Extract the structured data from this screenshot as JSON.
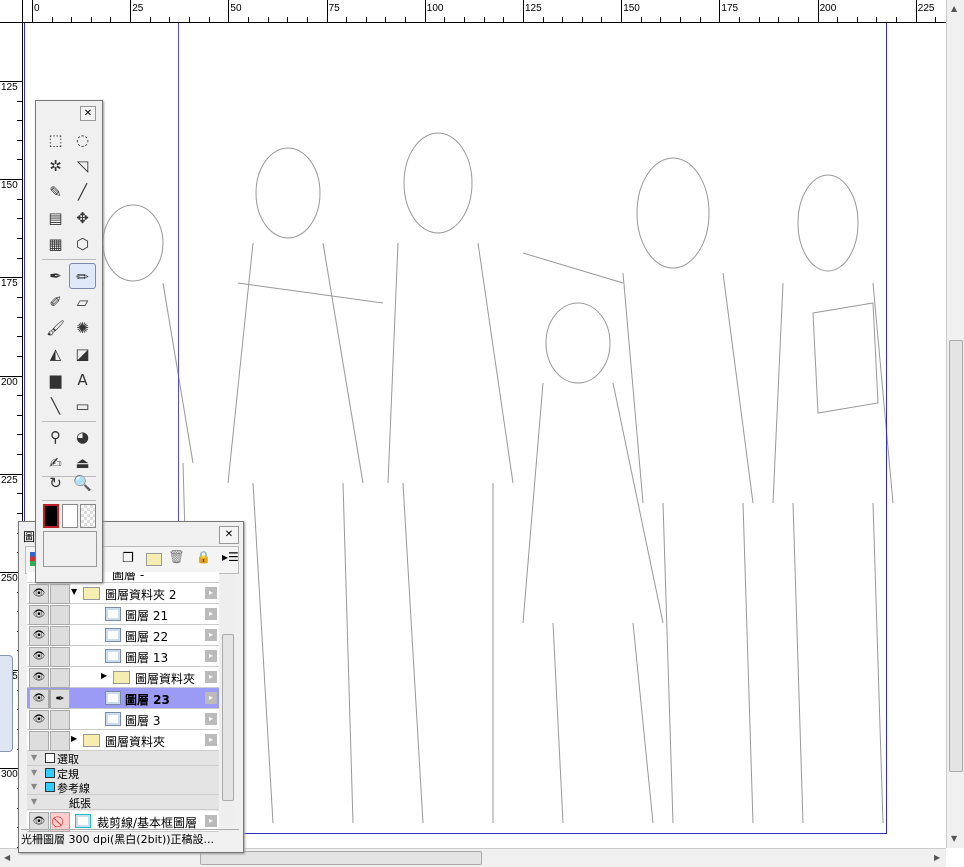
{
  "rulers": {
    "top_labels": [
      "0",
      "25",
      "50",
      "75",
      "100",
      "125",
      "150",
      "175",
      "200",
      "225"
    ],
    "left_labels": [
      "125",
      "150",
      "175",
      "200",
      "225",
      "250",
      "275",
      "300"
    ]
  },
  "toolbox": {
    "close_icon": "close-icon",
    "tools": [
      "rect-select",
      "lasso",
      "magic-wand",
      "object-select",
      "select-pen",
      "eyedropper",
      "perspective",
      "move",
      "grid",
      "3d-select",
      "pen",
      "pencil",
      "marker",
      "eraser",
      "brush",
      "airbrush",
      "fill",
      "pattern-fill",
      "gradient",
      "text",
      "line",
      "rectangle",
      "correct-line",
      "color-blend",
      "pen-adjust",
      "stamp",
      "rotate",
      "zoom"
    ],
    "active_tool": "pencil",
    "colors": {
      "foreground": "#000000",
      "background": "#ffffff",
      "border": "#c02020"
    }
  },
  "layers": {
    "title": "圖",
    "partial_row": "圖層 -",
    "rows": [
      {
        "name": "圖層資料夾 2",
        "type": "folder-open",
        "visible": true
      },
      {
        "name": "圖層 21",
        "type": "layer",
        "visible": true
      },
      {
        "name": "圖層 22",
        "type": "layer",
        "visible": true
      },
      {
        "name": "圖層 13",
        "type": "layer",
        "visible": true
      },
      {
        "name": "圖層資料夾",
        "type": "folder",
        "visible": true
      },
      {
        "name": "圖層 23",
        "type": "layer",
        "visible": true,
        "selected": true
      },
      {
        "name": "圖層 3",
        "type": "layer",
        "visible": true
      },
      {
        "name": "圖層資料夾",
        "type": "folder",
        "visible": false
      }
    ],
    "sections": [
      "選取",
      "定規",
      "参考線",
      "紙張"
    ],
    "crop_layer": "裁剪線/基本框圖層",
    "status": "光柵圖層 300 dpi(黑白(2bit))正稿設...",
    "selection_color": "#9b9bf5"
  }
}
